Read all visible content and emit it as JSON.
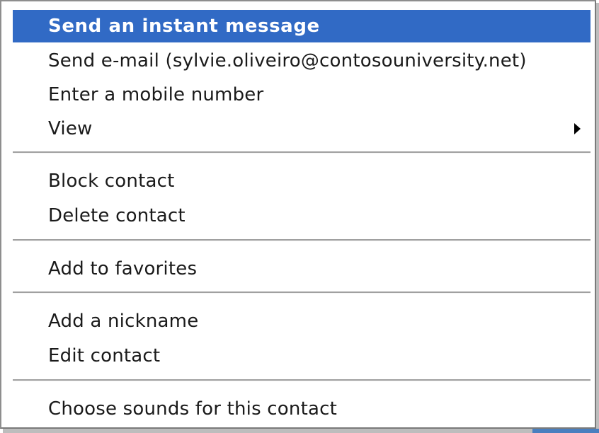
{
  "context_menu": {
    "items": [
      {
        "label": "Send an instant message",
        "highlighted": true
      },
      {
        "label": "Send e-mail (sylvie.oliveiro@contosouniversity.net)"
      },
      {
        "label": "Enter a mobile number"
      },
      {
        "label": "View",
        "has_submenu": true
      },
      {
        "label": "Block contact"
      },
      {
        "label": "Delete contact"
      },
      {
        "label": "Add to favorites"
      },
      {
        "label": "Add a nickname"
      },
      {
        "label": "Edit contact"
      },
      {
        "label": "Choose sounds for this contact"
      }
    ]
  },
  "colors": {
    "highlight_background": "#316ac5",
    "highlight_text": "#ffffff",
    "menu_background": "#ffffff",
    "separator": "#a0a0a0"
  },
  "icons": {
    "submenu_arrow": "submenu-arrow-icon"
  }
}
